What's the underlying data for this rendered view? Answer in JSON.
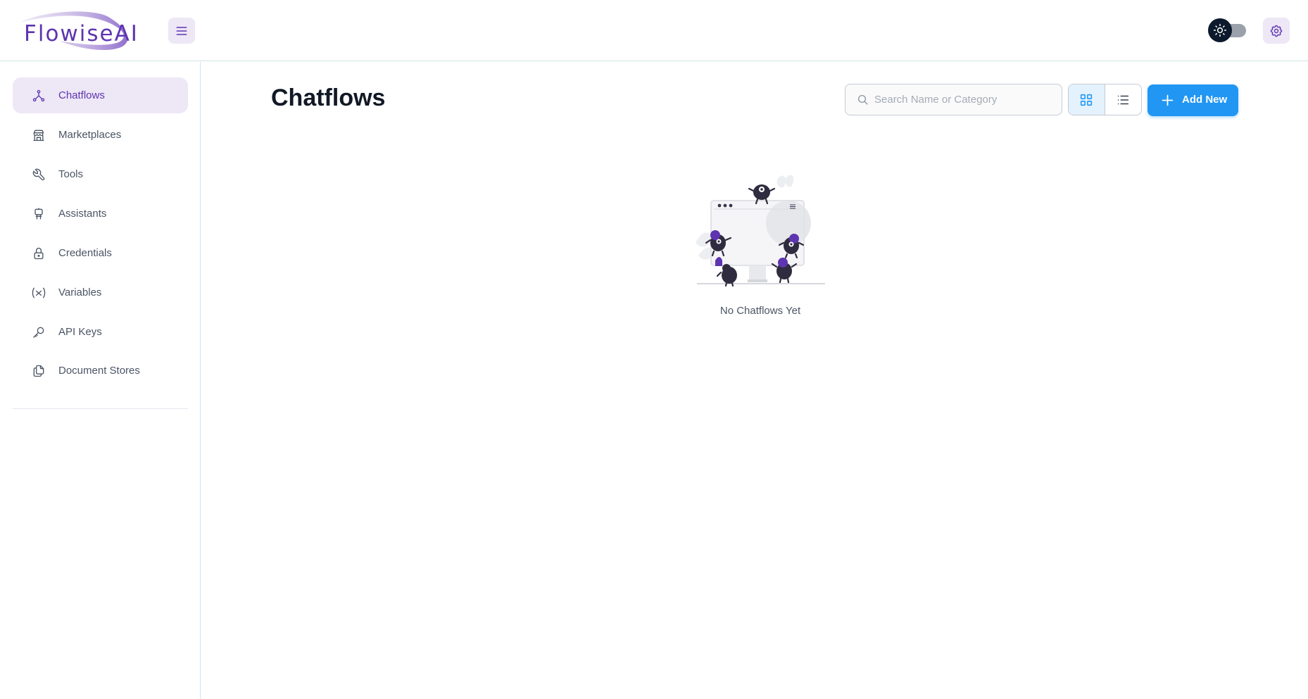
{
  "app": {
    "logo_text": "FlowiseAI"
  },
  "colors": {
    "accent": "#5e35b1",
    "primary": "#2196f3",
    "accent_bg": "#ede7f6"
  },
  "header": {
    "menu_icon": "hamburger-icon",
    "theme_toggle_icon": "sun-icon",
    "settings_icon": "gear-icon"
  },
  "sidebar": {
    "items": [
      {
        "label": "Chatflows",
        "icon": "hierarchy-icon",
        "active": true
      },
      {
        "label": "Marketplaces",
        "icon": "store-icon",
        "active": false
      },
      {
        "label": "Tools",
        "icon": "wrench-icon",
        "active": false
      },
      {
        "label": "Assistants",
        "icon": "robot-icon",
        "active": false
      },
      {
        "label": "Credentials",
        "icon": "lock-icon",
        "active": false
      },
      {
        "label": "Variables",
        "icon": "variable-icon",
        "active": false
      },
      {
        "label": "API Keys",
        "icon": "key-icon",
        "active": false
      },
      {
        "label": "Document Stores",
        "icon": "files-icon",
        "active": false
      }
    ]
  },
  "main": {
    "title": "Chatflows",
    "search": {
      "placeholder": "Search Name or Category",
      "value": ""
    },
    "view_toggle": {
      "selected": "card"
    },
    "add_button_label": "Add New",
    "empty_state_text": "No Chatflows Yet"
  }
}
